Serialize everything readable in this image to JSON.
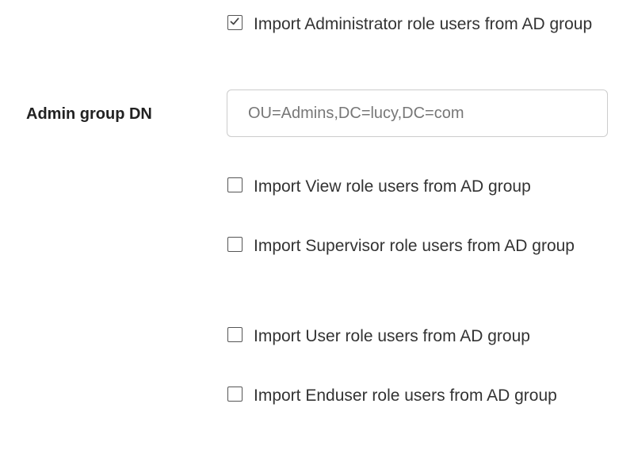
{
  "admin_import": {
    "label": "Import Administrator role users from AD group",
    "checked": true
  },
  "admin_group_dn": {
    "label": "Admin group DN",
    "value": "",
    "placeholder": "OU=Admins,DC=lucy,DC=com"
  },
  "view_import": {
    "label": "Import View role users from AD group",
    "checked": false
  },
  "supervisor_import": {
    "label": "Import Supervisor role users from AD group",
    "checked": false
  },
  "user_import": {
    "label": "Import User role users from AD group",
    "checked": false
  },
  "enduser_import": {
    "label": "Import Enduser role users from AD group",
    "checked": false
  },
  "icons": {
    "checked": "check-icon"
  },
  "colors": {
    "text": "#333333",
    "checkbox_border": "#555555",
    "input_border": "#cccccc"
  }
}
